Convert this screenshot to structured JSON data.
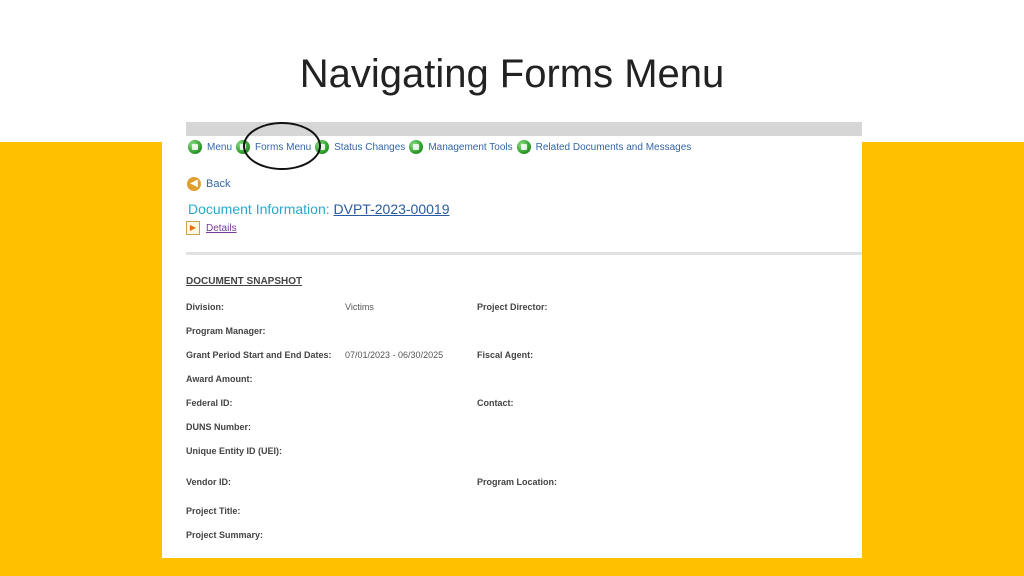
{
  "slide": {
    "title": "Navigating Forms Menu"
  },
  "colors": {
    "band": "#FFC000",
    "link": "#3366aa",
    "doc_info": "#2aa9c9"
  },
  "nav": {
    "items": [
      {
        "label": "Menu",
        "icon": "menu-icon"
      },
      {
        "label": "Forms Menu",
        "icon": "forms-icon"
      },
      {
        "label": "Status Changes",
        "icon": "status-icon"
      },
      {
        "label": "Management Tools",
        "icon": "tools-icon"
      },
      {
        "label": "Related Documents and Messages",
        "icon": "messages-icon"
      }
    ]
  },
  "back": {
    "label": "Back"
  },
  "document": {
    "prefix": "Document Information: ",
    "id": "DVPT-2023-00019"
  },
  "details": {
    "label": "Details"
  },
  "snapshot": {
    "title": "DOCUMENT SNAPSHOT",
    "division_label": "Division:",
    "division_value": "Victims",
    "project_director_label": "Project Director:",
    "program_manager_label": "Program Manager:",
    "grant_period_label": "Grant Period Start and End Dates:",
    "grant_period_value": "07/01/2023 - 06/30/2025",
    "fiscal_agent_label": "Fiscal Agent:",
    "award_amount_label": "Award Amount:",
    "federal_id_label": "Federal ID:",
    "contact_label": "Contact:",
    "duns_label": "DUNS Number:",
    "uei_label": "Unique Entity ID (UEI):",
    "vendor_id_label": "Vendor ID:",
    "program_location_label": "Program Location:",
    "project_title_label": "Project Title:",
    "project_summary_label": "Project Summary:"
  }
}
